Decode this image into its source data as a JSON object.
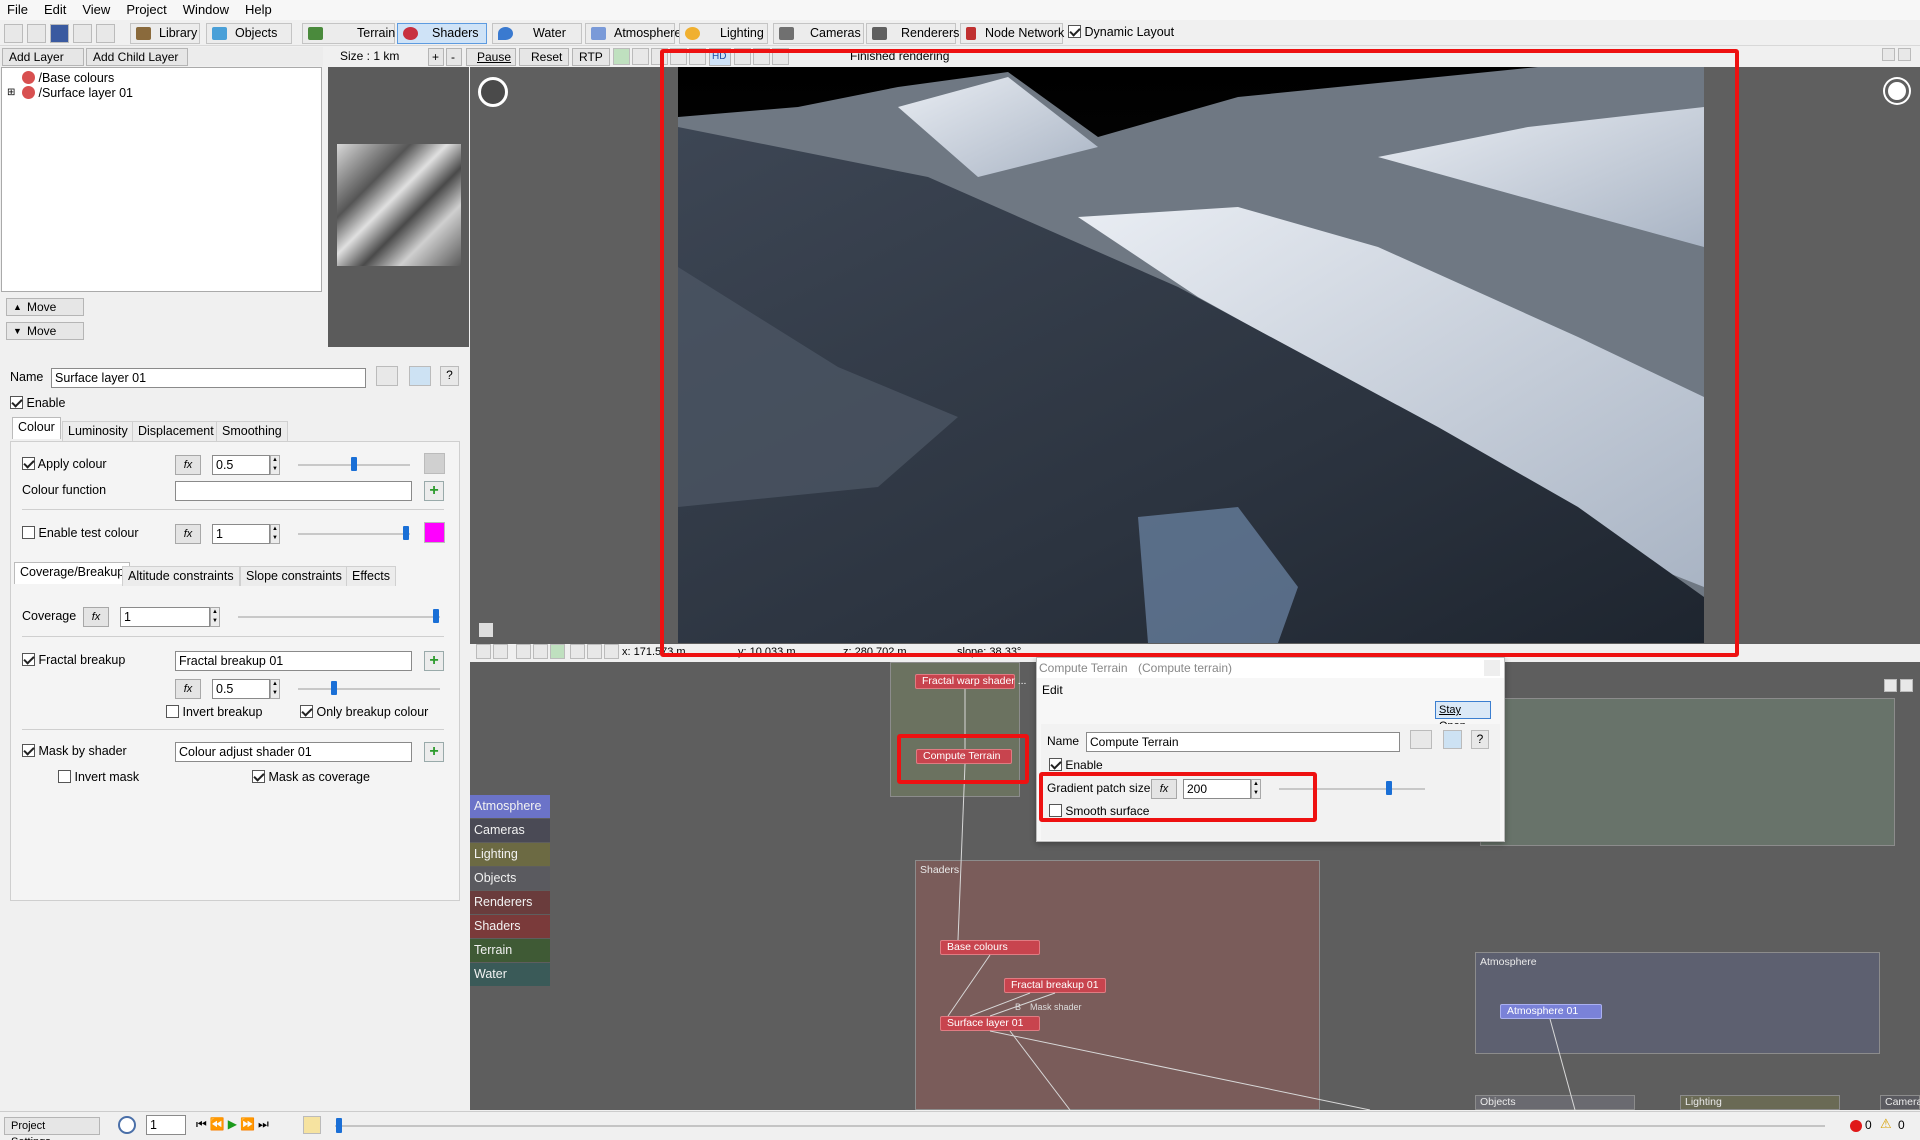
{
  "menu": [
    "File",
    "Edit",
    "View",
    "Project",
    "Window",
    "Help"
  ],
  "toolbar": {
    "buttons": [
      {
        "label": "Library",
        "icon": "library-icon",
        "color": "#8a6a3c"
      },
      {
        "label": "Objects",
        "icon": "objects-icon",
        "color": "#4aa0d8"
      },
      {
        "label": "Terrain",
        "icon": "terrain-icon",
        "color": "#4a8a3c"
      },
      {
        "label": "Shaders",
        "icon": "shaders-icon",
        "color": "#c83040"
      },
      {
        "label": "Water",
        "icon": "water-icon",
        "color": "#3a7ad0"
      },
      {
        "label": "Atmosphere",
        "icon": "atmosphere-icon",
        "color": "#7a9ad8"
      },
      {
        "label": "Lighting",
        "icon": "lighting-icon",
        "color": "#f0b030"
      },
      {
        "label": "Cameras",
        "icon": "cameras-icon",
        "color": "#707070"
      },
      {
        "label": "Renderers",
        "icon": "renderers-icon",
        "color": "#606060"
      },
      {
        "label": "Node Network",
        "icon": "node-network-icon",
        "color": "#c03030"
      }
    ],
    "dynamic_layout": "Dynamic Layout"
  },
  "layers": {
    "add_layer": "Add Layer",
    "add_child_layer": "Add Child Layer",
    "items": [
      "/Base colours",
      "/Surface layer 01"
    ],
    "move_up": "Move",
    "move_down": "Move"
  },
  "preview_controls": {
    "size": "Size : 1 km",
    "plus": "+",
    "minus": "-",
    "pause": "Pause",
    "reset": "Reset",
    "rtp": "RTP",
    "hd": "HD",
    "status": "Finished rendering"
  },
  "coords": {
    "x": "x: 171.573 m",
    "y": "y: 10.033 m",
    "z": "z: 280.702 m",
    "slope": "slope: 38.33°"
  },
  "props": {
    "name_label": "Name",
    "name_value": "Surface layer 01",
    "enable": "Enable",
    "tabs1": [
      "Colour",
      "Luminosity",
      "Displacement",
      "Smoothing"
    ],
    "apply_colour": "Apply colour",
    "apply_colour_value": "0.5",
    "colour_function": "Colour function",
    "enable_test_colour": "Enable test colour",
    "test_colour_value": "1",
    "tabs2": [
      "Coverage/Breakup",
      "Altitude constraints",
      "Slope constraints",
      "Effects"
    ],
    "coverage": "Coverage",
    "coverage_value": "1",
    "fractal_breakup": "Fractal breakup",
    "fractal_breakup_value": "Fractal breakup 01",
    "breakup_amount": "0.5",
    "invert_breakup": "Invert breakup",
    "only_breakup_colour": "Only breakup colour",
    "mask_by_shader": "Mask by shader",
    "mask_value": "Colour adjust shader 01",
    "invert_mask": "Invert mask",
    "mask_as_coverage": "Mask as coverage"
  },
  "popup": {
    "title": "Compute Terrain",
    "subtitle": "(Compute terrain)",
    "edit": "Edit",
    "stay_open": "Stay Open",
    "name_label": "Name",
    "name_value": "Compute Terrain",
    "enable": "Enable",
    "gradient_patch_size": "Gradient patch size",
    "gradient_value": "200",
    "smooth_surface": "Smooth surface"
  },
  "categories": [
    {
      "label": "Atmosphere",
      "color": "#6b73c8"
    },
    {
      "label": "Cameras",
      "color": "#4a4a55"
    },
    {
      "label": "Lighting",
      "color": "#6c6a43"
    },
    {
      "label": "Objects",
      "color": "#5a5a5f"
    },
    {
      "label": "Renderers",
      "color": "#6a3c3c"
    },
    {
      "label": "Shaders",
      "color": "#7a3a3a"
    },
    {
      "label": "Terrain",
      "color": "#3f5a35"
    },
    {
      "label": "Water",
      "color": "#3a5a58"
    }
  ],
  "graph": {
    "fractal_warp": "Fractal warp shader ...",
    "compute_terrain": "Compute Terrain",
    "shaders_group": "Shaders",
    "base_colours": "Base colours",
    "fractal_breakup": "Fractal breakup 01",
    "mask_shader": "Mask shader",
    "b_label": "B",
    "surface_layer": "Surface layer 01",
    "atmosphere_group": "Atmosphere",
    "atmosphere_node": "Atmosphere 01",
    "objects_group": "Objects",
    "lighting_group": "Lighting",
    "cameras_group": "Camera"
  },
  "status": {
    "project_settings": "Project Settings...",
    "frame": "1",
    "errors": "0",
    "warnings": "0"
  }
}
